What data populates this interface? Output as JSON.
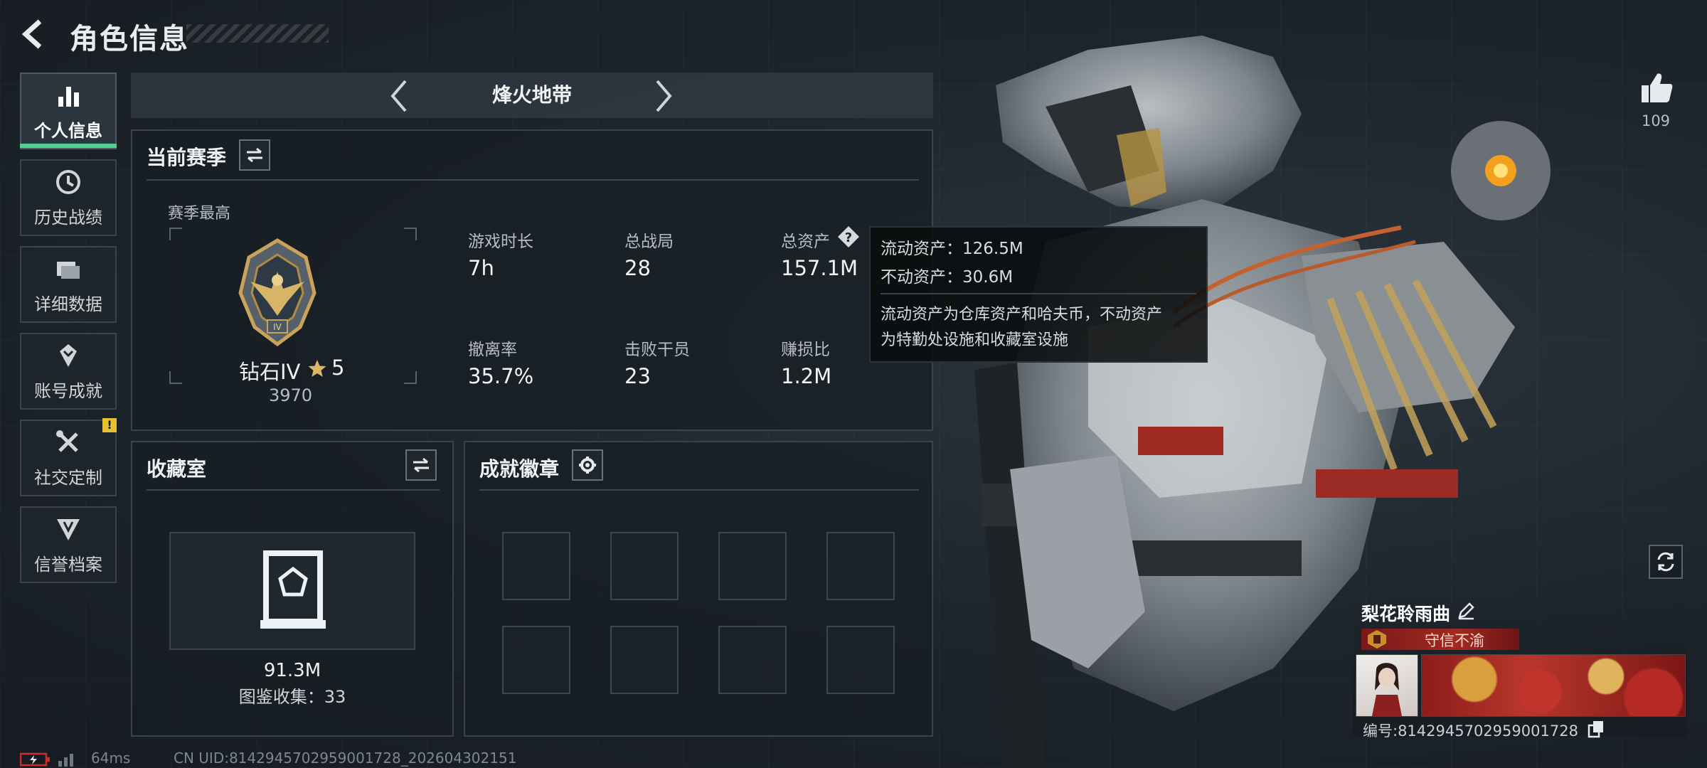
{
  "header": {
    "title": "角色信息"
  },
  "nav": {
    "items": [
      {
        "label": "个人信息",
        "icon": "bar-chart-icon",
        "active": true
      },
      {
        "label": "历史战绩",
        "icon": "history-clock-icon"
      },
      {
        "label": "详细数据",
        "icon": "folder-icon"
      },
      {
        "label": "账号成就",
        "icon": "achievement-icon"
      },
      {
        "label": "社交定制",
        "icon": "tools-icon",
        "badge": "!"
      },
      {
        "label": "信誉档案",
        "icon": "shield-emblem-icon"
      }
    ]
  },
  "mode": {
    "label": "烽火地带"
  },
  "season": {
    "title": "当前赛季",
    "best_label": "赛季最高",
    "rank_name": "钻石IV",
    "rank_stars": "5",
    "rank_score": "3970",
    "stats": [
      {
        "label": "游戏时长",
        "value": "7h"
      },
      {
        "label": "总战局",
        "value": "28"
      },
      {
        "label": "总资产",
        "value": "157.1M"
      },
      {
        "label": "撤离率",
        "value": "35.7%"
      },
      {
        "label": "击败干员",
        "value": "23"
      },
      {
        "label": "赚损比",
        "value": "1.2M"
      }
    ]
  },
  "tooltip": {
    "line1": "流动资产：126.5M",
    "line2": "不动资产：30.6M",
    "desc1": "流动资产为仓库资产和哈夫币，不动资产",
    "desc2": "为特勤处设施和收藏室设施"
  },
  "collection": {
    "title": "收藏室",
    "value": "91.3M",
    "subtitle": "图鉴收集：33"
  },
  "badges": {
    "title": "成就徽章",
    "slots": 8
  },
  "likes": {
    "count": "109"
  },
  "player_card": {
    "name": "梨花聆雨曲",
    "honor_title": "守信不渝",
    "id_text": "编号:8142945702959001728"
  },
  "status": {
    "ping": "64ms",
    "uid": "CN UID:8142945702959001728_202604302151"
  },
  "colors": {
    "accent": "#4fd08f",
    "warning": "#e6c233",
    "title_red": "#a12a22"
  }
}
